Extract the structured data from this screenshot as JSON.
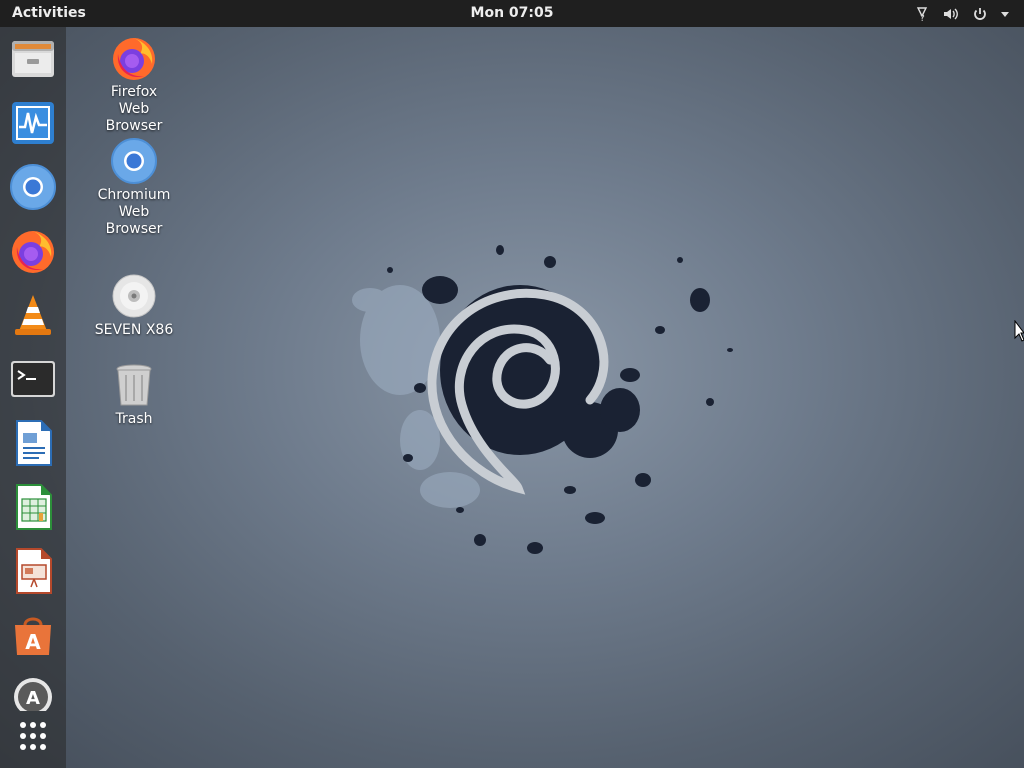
{
  "topbar": {
    "activities": "Activities",
    "clock": "Mon 07:05",
    "tray_icons": [
      "network-icon",
      "volume-icon",
      "power-icon",
      "system-menu-arrow-icon"
    ]
  },
  "dock": {
    "items": [
      {
        "name": "Files",
        "icon": "file-cabinet-icon"
      },
      {
        "name": "System Monitor",
        "icon": "system-monitor-icon"
      },
      {
        "name": "Chromium Web Browser",
        "icon": "chromium-icon"
      },
      {
        "name": "Firefox Web Browser",
        "icon": "firefox-icon"
      },
      {
        "name": "VLC media player",
        "icon": "vlc-icon"
      },
      {
        "name": "Terminal",
        "icon": "terminal-icon"
      },
      {
        "name": "LibreOffice Writer",
        "icon": "writer-icon"
      },
      {
        "name": "LibreOffice Calc",
        "icon": "calc-icon"
      },
      {
        "name": "LibreOffice Impress",
        "icon": "impress-icon"
      },
      {
        "name": "Software",
        "icon": "software-center-icon"
      },
      {
        "name": "Updates",
        "icon": "update-icon"
      },
      {
        "name": "Show Applications",
        "icon": "app-grid-icon"
      }
    ]
  },
  "desktop": {
    "icons": [
      {
        "label": "Firefox\nWeb\nBrowser",
        "icon": "firefox-icon"
      },
      {
        "label": "Chromium\nWeb\nBrowser",
        "icon": "chromium-icon"
      },
      {
        "label": "SEVEN X86",
        "icon": "cd-rom-icon"
      },
      {
        "label": "Trash",
        "icon": "trash-icon"
      }
    ]
  },
  "colors": {
    "topbar_bg": "#1f1f1f",
    "wallpaper_center": "#8a97a7",
    "wallpaper_edge": "#454e5a",
    "swirl": "#c8cdd3",
    "splatter": "#1a2233"
  }
}
